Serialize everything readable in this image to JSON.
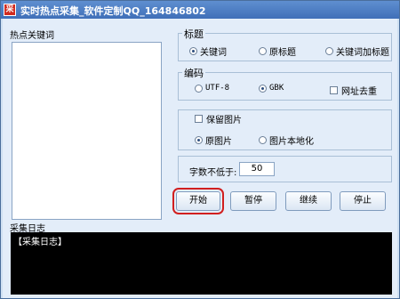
{
  "window": {
    "title": "实时热点采集_软件定制QQ_164846802",
    "icon_label": "采"
  },
  "hot_keywords": {
    "label": "热点关键词"
  },
  "title_group": {
    "label": "标题",
    "options": [
      "关键词",
      "原标题",
      "关键词加标题"
    ],
    "selected": 0
  },
  "encoding_group": {
    "label": "编码",
    "options": [
      "UTF-8",
      "GBK"
    ],
    "selected": 1,
    "dedupe_label": "网址去重"
  },
  "image_group": {
    "keep_label": "保留图片",
    "options": [
      "原图片",
      "图片本地化"
    ],
    "selected": 0
  },
  "min_chars": {
    "label": "字数不低于:",
    "value": "50"
  },
  "buttons": {
    "start": "开始",
    "pause": "暂停",
    "resume": "继续",
    "stop": "停止"
  },
  "log": {
    "label": "采集日志",
    "text": "【采集日志】"
  }
}
